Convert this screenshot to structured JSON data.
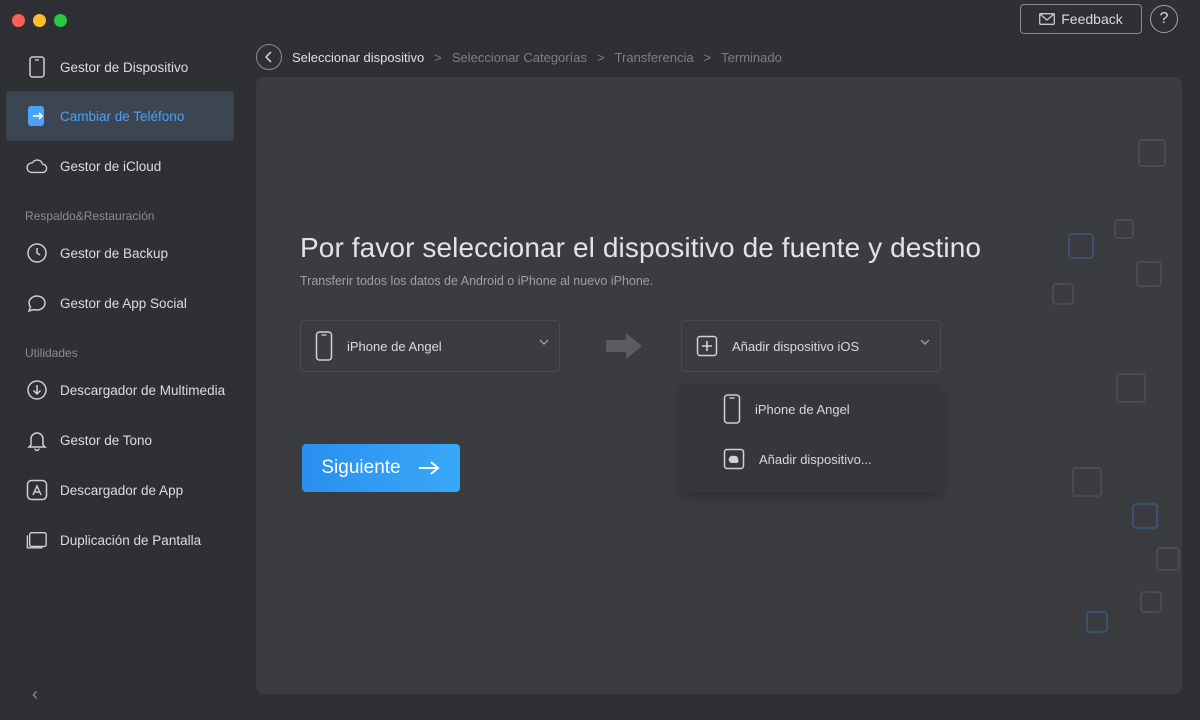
{
  "window": {
    "feedback_label": "Feedback",
    "help_label": "?"
  },
  "sidebar": {
    "items": [
      {
        "label": "Gestor de Dispositivo",
        "icon": "phone-icon"
      },
      {
        "label": "Cambiar de Teléfono",
        "icon": "phone-switch-icon",
        "active": true
      },
      {
        "label": "Gestor de iCloud",
        "icon": "cloud-icon"
      }
    ],
    "sections": [
      {
        "label": "Respaldo&Restauración",
        "items": [
          {
            "label": "Gestor de Backup",
            "icon": "history-icon"
          },
          {
            "label": "Gestor de App Social",
            "icon": "chat-icon"
          }
        ]
      },
      {
        "label": "Utilidades",
        "items": [
          {
            "label": "Descargador de Multimedia",
            "icon": "download-icon"
          },
          {
            "label": "Gestor de Tono",
            "icon": "bell-icon"
          },
          {
            "label": "Descargador de App",
            "icon": "app-store-icon"
          },
          {
            "label": "Duplicación de Pantalla",
            "icon": "screen-mirror-icon"
          }
        ]
      }
    ],
    "collapse_label": "‹"
  },
  "breadcrumb": {
    "steps": [
      "Seleccionar dispositivo",
      "Seleccionar Categorías",
      "Transferencia",
      "Terminado"
    ],
    "separator": ">"
  },
  "main": {
    "title": "Por favor seleccionar el dispositivo de fuente y destino",
    "subtitle": "Transferir todos los datos de Android o iPhone al nuevo iPhone.",
    "source_device": "iPhone de Angel",
    "target_device": "Añadir dispositivo iOS",
    "dropdown_options": [
      "iPhone de Angel",
      "Añadir dispositivo..."
    ],
    "next_label": "Siguiente"
  },
  "colors": {
    "accent": "#2a8ff0",
    "active_text": "#4aa3f5",
    "background": "#2f3033",
    "panel": "#3b3c40"
  }
}
